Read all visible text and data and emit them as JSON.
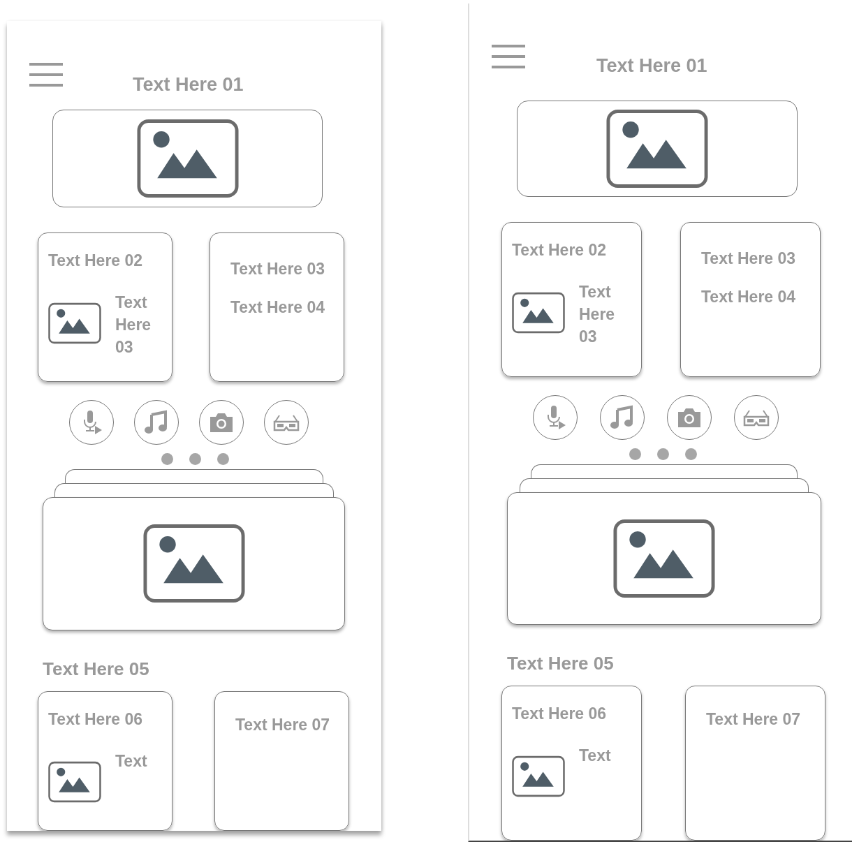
{
  "screens": [
    {
      "title": "Text Here 01",
      "tile_a": {
        "heading": "Text Here 02",
        "caption": "Text Here 03"
      },
      "tile_b": {
        "lines": [
          "Text Here 03",
          "Text Here 04"
        ]
      },
      "section_title": "Text Here 05",
      "tile_c": {
        "heading": "Text Here 06",
        "caption": "Text"
      },
      "tile_d": {
        "lines": [
          "Text Here 07"
        ]
      }
    },
    {
      "title": "Text Here 01",
      "tile_a": {
        "heading": "Text Here 02",
        "caption": "Text Here 03"
      },
      "tile_b": {
        "lines": [
          "Text Here 03",
          "Text Here 04"
        ]
      },
      "section_title": "Text Here 05",
      "tile_c": {
        "heading": "Text Here 06",
        "caption": "Text"
      },
      "tile_d": {
        "lines": [
          "Text Here 07"
        ]
      }
    }
  ]
}
